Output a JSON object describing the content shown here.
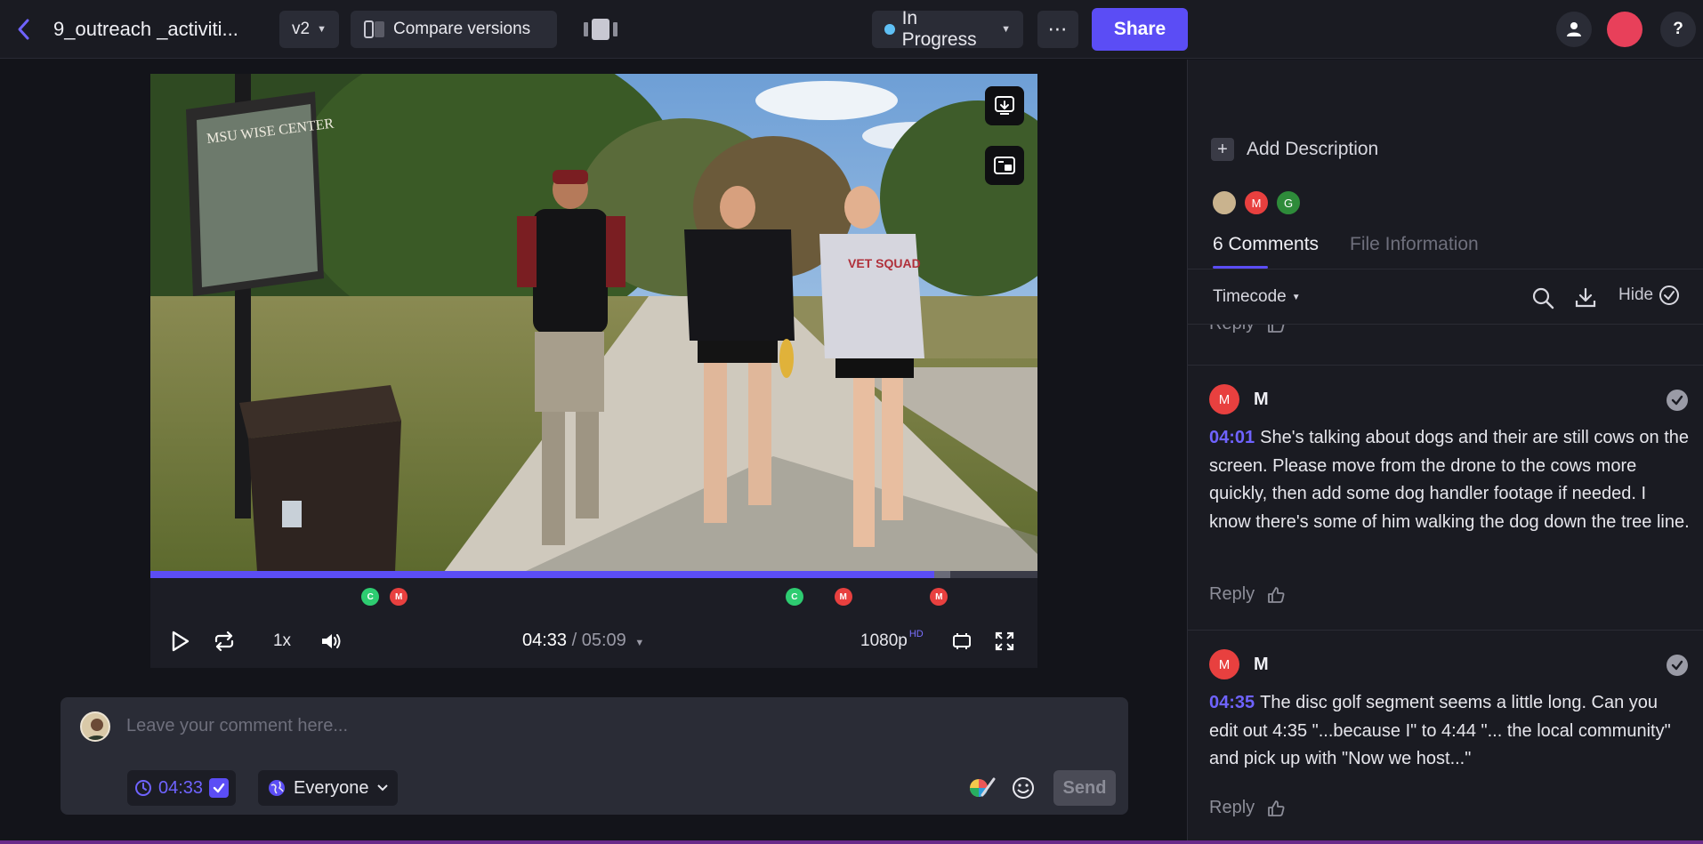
{
  "header": {
    "file_name": "9_outreach _activiti...",
    "version": "v2",
    "compare_label": "Compare versions",
    "status": "In Progress",
    "status_color": "#5fc0f5",
    "more_label": "⋯",
    "share_label": "Share",
    "help_label": "?",
    "avatar_color": "#e8405a"
  },
  "video": {
    "scene": "Three people walking on a path beside the MSU WISE Center disc golf course sign",
    "sign_text": "MSU WISE CENTER",
    "progress_fraction": 0.884,
    "buffered_fraction": 0.902,
    "markers": [
      {
        "label": "C",
        "color": "#2ecc71",
        "time_fraction": 0.248
      },
      {
        "label": "M",
        "color": "#e8403f",
        "time_fraction": 0.28
      },
      {
        "label": "C",
        "color": "#2ecc71",
        "time_fraction": 0.726
      },
      {
        "label": "M",
        "color": "#e8403f",
        "time_fraction": 0.781
      },
      {
        "label": "M",
        "color": "#e8403f",
        "time_fraction": 0.889
      }
    ]
  },
  "controls": {
    "speed": "1x",
    "current_time": "04:33",
    "separator": " / ",
    "duration": "05:09",
    "quality": "1080p",
    "quality_badge": "HD"
  },
  "comment_box": {
    "placeholder": "Leave your comment here...",
    "timecode": "04:33",
    "audience": "Everyone",
    "send_label": "Send"
  },
  "panel": {
    "add_description": "Add Description",
    "viewers": [
      {
        "label": "",
        "color": "#c9b38e"
      },
      {
        "label": "M",
        "color": "#e8403f"
      },
      {
        "label": "G",
        "color": "#2e8b3a"
      }
    ],
    "tab_comments": "6 Comments",
    "tab_file_info": "File Information",
    "sort_label": "Timecode",
    "hide_label": "Hide",
    "reply_label": "Reply",
    "comments": [
      {
        "initial": "M",
        "author": "M",
        "timecode": "04:01",
        "text": "She's talking about dogs and their are still cows on the screen. Please move from the drone to the cows more quickly, then add some dog handler footage if needed. I know there's some of him walking the dog down the tree line."
      },
      {
        "initial": "M",
        "author": "M",
        "timecode": "04:35",
        "text": "The disc golf segment seems a little long. Can you edit out 4:35 \"...because I\" to 4:44 \"... the local community\" and pick up  with \"Now we host...\""
      }
    ]
  }
}
